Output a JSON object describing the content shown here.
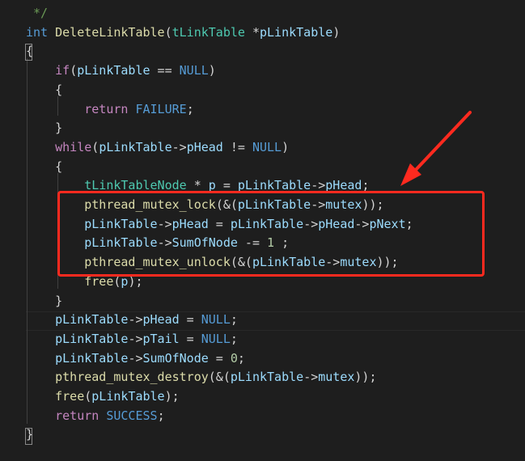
{
  "editor": {
    "theme_colors": {
      "background": "#1e1e1e",
      "annotation": "#ff2a1f"
    },
    "annotation": "arrow pointing to a red rectangle",
    "lines": [
      [
        {
          "t": " */",
          "c": "comment"
        }
      ],
      [
        {
          "t": "int",
          "c": "keyword"
        },
        {
          "t": " ",
          "c": "punct"
        },
        {
          "t": "DeleteLinkTable",
          "c": "func"
        },
        {
          "t": "(",
          "c": "punct"
        },
        {
          "t": "tLinkTable",
          "c": "type"
        },
        {
          "t": " *",
          "c": "punct"
        },
        {
          "t": "pLinkTable",
          "c": "param"
        },
        {
          "t": ")",
          "c": "punct"
        }
      ],
      [
        {
          "t": "{",
          "c": "punct"
        }
      ],
      [
        {
          "t": "    ",
          "c": "punct"
        },
        {
          "t": "if",
          "c": "control"
        },
        {
          "t": "(",
          "c": "punct"
        },
        {
          "t": "pLinkTable",
          "c": "var"
        },
        {
          "t": " == ",
          "c": "punct"
        },
        {
          "t": "NULL",
          "c": "const"
        },
        {
          "t": ")",
          "c": "punct"
        }
      ],
      [
        {
          "t": "    {",
          "c": "punct"
        }
      ],
      [
        {
          "t": "        ",
          "c": "punct"
        },
        {
          "t": "return",
          "c": "control"
        },
        {
          "t": " ",
          "c": "punct"
        },
        {
          "t": "FAILURE",
          "c": "const"
        },
        {
          "t": ";",
          "c": "punct"
        }
      ],
      [
        {
          "t": "    }",
          "c": "punct"
        }
      ],
      [
        {
          "t": "    ",
          "c": "punct"
        },
        {
          "t": "while",
          "c": "control"
        },
        {
          "t": "(",
          "c": "punct"
        },
        {
          "t": "pLinkTable",
          "c": "var"
        },
        {
          "t": "->",
          "c": "punct"
        },
        {
          "t": "pHead",
          "c": "var"
        },
        {
          "t": " != ",
          "c": "punct"
        },
        {
          "t": "NULL",
          "c": "const"
        },
        {
          "t": ")",
          "c": "punct"
        }
      ],
      [
        {
          "t": "    {",
          "c": "punct"
        }
      ],
      [
        {
          "t": "        ",
          "c": "punct"
        },
        {
          "t": "tLinkTableNode",
          "c": "type"
        },
        {
          "t": " * ",
          "c": "punct"
        },
        {
          "t": "p",
          "c": "var"
        },
        {
          "t": " = ",
          "c": "punct"
        },
        {
          "t": "pLinkTable",
          "c": "var"
        },
        {
          "t": "->",
          "c": "punct"
        },
        {
          "t": "pHead",
          "c": "var"
        },
        {
          "t": ";",
          "c": "punct"
        }
      ],
      [
        {
          "t": "        ",
          "c": "punct"
        },
        {
          "t": "pthread_mutex_lock",
          "c": "func"
        },
        {
          "t": "(&(",
          "c": "punct"
        },
        {
          "t": "pLinkTable",
          "c": "var"
        },
        {
          "t": "->",
          "c": "punct"
        },
        {
          "t": "mutex",
          "c": "var"
        },
        {
          "t": "));",
          "c": "punct"
        }
      ],
      [
        {
          "t": "        ",
          "c": "punct"
        },
        {
          "t": "pLinkTable",
          "c": "var"
        },
        {
          "t": "->",
          "c": "punct"
        },
        {
          "t": "pHead",
          "c": "var"
        },
        {
          "t": " = ",
          "c": "punct"
        },
        {
          "t": "pLinkTable",
          "c": "var"
        },
        {
          "t": "->",
          "c": "punct"
        },
        {
          "t": "pHead",
          "c": "var"
        },
        {
          "t": "->",
          "c": "punct"
        },
        {
          "t": "pNext",
          "c": "var"
        },
        {
          "t": ";",
          "c": "punct"
        }
      ],
      [
        {
          "t": "        ",
          "c": "punct"
        },
        {
          "t": "pLinkTable",
          "c": "var"
        },
        {
          "t": "->",
          "c": "punct"
        },
        {
          "t": "SumOfNode",
          "c": "var"
        },
        {
          "t": " -= ",
          "c": "punct"
        },
        {
          "t": "1",
          "c": "num"
        },
        {
          "t": " ;",
          "c": "punct"
        }
      ],
      [
        {
          "t": "        ",
          "c": "punct"
        },
        {
          "t": "pthread_mutex_unlock",
          "c": "func"
        },
        {
          "t": "(&(",
          "c": "punct"
        },
        {
          "t": "pLinkTable",
          "c": "var"
        },
        {
          "t": "->",
          "c": "punct"
        },
        {
          "t": "mutex",
          "c": "var"
        },
        {
          "t": "));",
          "c": "punct"
        }
      ],
      [
        {
          "t": "        ",
          "c": "punct"
        },
        {
          "t": "free",
          "c": "func"
        },
        {
          "t": "(",
          "c": "punct"
        },
        {
          "t": "p",
          "c": "var"
        },
        {
          "t": ");",
          "c": "punct"
        }
      ],
      [
        {
          "t": "    }",
          "c": "punct"
        }
      ],
      [
        {
          "t": "    ",
          "c": "punct"
        },
        {
          "t": "pLinkTable",
          "c": "var"
        },
        {
          "t": "->",
          "c": "punct"
        },
        {
          "t": "pHead",
          "c": "var"
        },
        {
          "t": " = ",
          "c": "punct"
        },
        {
          "t": "NULL",
          "c": "const"
        },
        {
          "t": ";",
          "c": "punct"
        }
      ],
      [
        {
          "t": "    ",
          "c": "punct"
        },
        {
          "t": "pLinkTable",
          "c": "var"
        },
        {
          "t": "->",
          "c": "punct"
        },
        {
          "t": "pTail",
          "c": "var"
        },
        {
          "t": " = ",
          "c": "punct"
        },
        {
          "t": "NULL",
          "c": "const"
        },
        {
          "t": ";",
          "c": "punct"
        }
      ],
      [
        {
          "t": "    ",
          "c": "punct"
        },
        {
          "t": "pLinkTable",
          "c": "var"
        },
        {
          "t": "->",
          "c": "punct"
        },
        {
          "t": "SumOfNode",
          "c": "var"
        },
        {
          "t": " = ",
          "c": "punct"
        },
        {
          "t": "0",
          "c": "num"
        },
        {
          "t": ";",
          "c": "punct"
        }
      ],
      [
        {
          "t": "    ",
          "c": "punct"
        },
        {
          "t": "pthread_mutex_destroy",
          "c": "func"
        },
        {
          "t": "(&(",
          "c": "punct"
        },
        {
          "t": "pLinkTable",
          "c": "var"
        },
        {
          "t": "->",
          "c": "punct"
        },
        {
          "t": "mutex",
          "c": "var"
        },
        {
          "t": "));",
          "c": "punct"
        }
      ],
      [
        {
          "t": "    ",
          "c": "punct"
        },
        {
          "t": "free",
          "c": "func"
        },
        {
          "t": "(",
          "c": "punct"
        },
        {
          "t": "pLinkTable",
          "c": "var"
        },
        {
          "t": ");",
          "c": "punct"
        }
      ],
      [
        {
          "t": "    ",
          "c": "punct"
        },
        {
          "t": "return",
          "c": "control"
        },
        {
          "t": " ",
          "c": "punct"
        },
        {
          "t": "SUCCESS",
          "c": "const"
        },
        {
          "t": ";",
          "c": "punct"
        }
      ],
      [
        {
          "t": "}",
          "c": "punct"
        }
      ]
    ]
  }
}
